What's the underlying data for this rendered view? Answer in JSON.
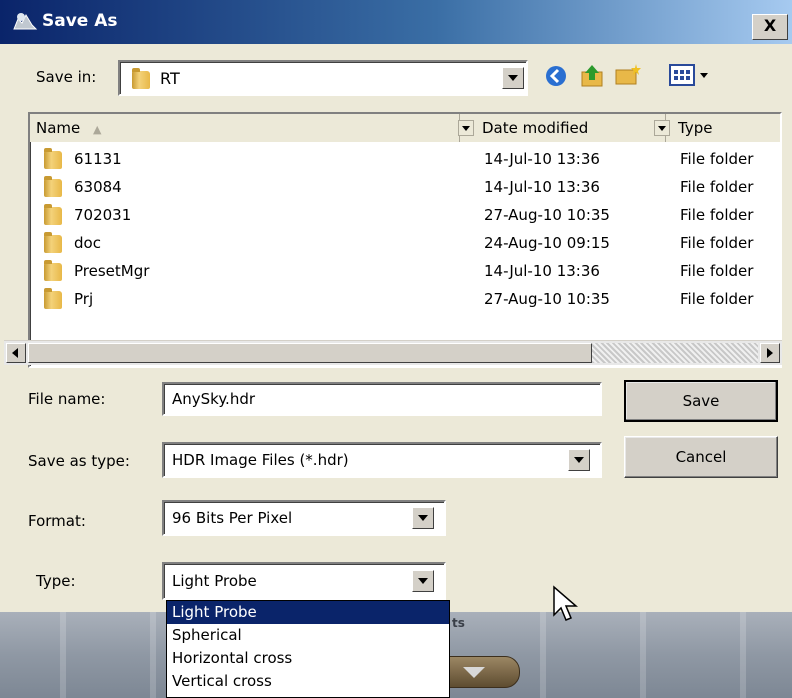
{
  "dialog": {
    "title": "Save As",
    "close_label": "X"
  },
  "toolbar": {
    "save_in_label": "Save in:",
    "save_in_value": "RT"
  },
  "file_list": {
    "columns": [
      "Name",
      "Date modified",
      "Type"
    ],
    "rows": [
      {
        "name": "61131",
        "date": "14-Jul-10 13:36",
        "type": "File folder"
      },
      {
        "name": "63084",
        "date": "14-Jul-10 13:36",
        "type": "File folder"
      },
      {
        "name": "702031",
        "date": "27-Aug-10 10:35",
        "type": "File folder"
      },
      {
        "name": "doc",
        "date": "24-Aug-10 09:15",
        "type": "File folder"
      },
      {
        "name": "PresetMgr",
        "date": "14-Jul-10 13:36",
        "type": "File folder"
      },
      {
        "name": "Prj",
        "date": "27-Aug-10 10:35",
        "type": "File folder"
      }
    ]
  },
  "form": {
    "file_name_label": "File name:",
    "file_name_value": "AnySky.hdr",
    "save_as_type_label": "Save as type:",
    "save_as_type_value": "HDR Image Files (*.hdr)",
    "format_label": "Format:",
    "format_value": "96 Bits Per Pixel",
    "type_label": "Type:",
    "type_value": "Light Probe"
  },
  "buttons": {
    "save": "Save",
    "cancel": "Cancel"
  },
  "type_options": [
    "Light Probe",
    "Spherical",
    "Horizontal cross",
    "Vertical cross"
  ],
  "background": {
    "partial_text": "ts"
  },
  "colors": {
    "title_start": "#0a246a",
    "title_end": "#a6caf0",
    "selection": "#0a246a"
  }
}
